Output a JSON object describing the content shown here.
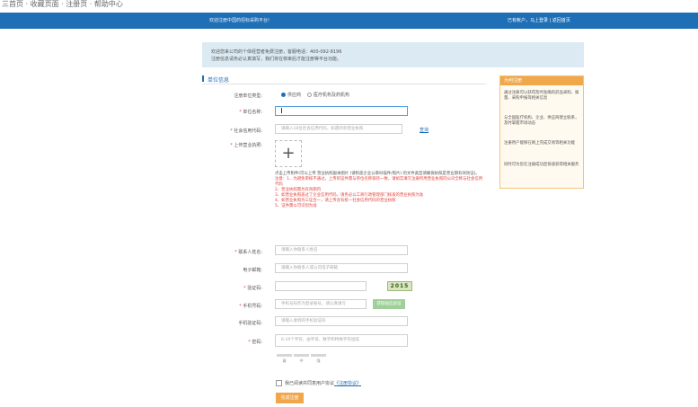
{
  "top_strip": "三首页 · 收藏页面 · 注册页 · 帮助中心",
  "header": {
    "welcome": "欢迎注册中国药招标采购平台!",
    "links": "已有帐户，马上登录 | 返回首页"
  },
  "notice": {
    "line1": "欢迎您来公司的个体经营者免费注册，客服电话：400-092-8196",
    "line2": "注册信息请务必认真填写，我们将在核审后才能注册等平台功能。"
  },
  "section_title": "单位信息",
  "form": {
    "type_label": "注册单位类型:",
    "type_options": [
      "供应商",
      "医疗机构及药机构"
    ],
    "name_label": "单位名称:",
    "credit_label": "社会信用代码:",
    "credit_placeholder": "请输入18位社会信用代码，如遇到有营业执照",
    "credit_link": "查询",
    "license_label": "上传营业执照:",
    "upload_plus": "+",
    "tips": [
      {
        "text": "点击上传附件(可以上传 营业执照副本图片 (请附盖企业公章扫描件/照片) 的文件类型请确保执照是营业期有效效证)。",
        "color": "dark"
      },
      {
        "text": "注意：1、为避免审核不通过，上传的证件需与单位名称保持一致，请如实填写注册所用营业执照的公司全称与社会信用代码",
        "color": "red"
      },
      {
        "text": "2、营业执照需为有效期内",
        "color": "red"
      },
      {
        "text": "3、如营业执照盖过了企业信用代码，请务必以工商行政管理部门核发的营业执照为准",
        "color": "red"
      },
      {
        "text": "4、如营业执照为三证合一，请上传含有统一社会信用代码的营业执照",
        "color": "red"
      },
      {
        "text": "5、证件需以可识别为准",
        "color": "red"
      }
    ],
    "contact_label": "联系人姓名:",
    "contact_placeholder": "请输入你联系人姓名",
    "email_label": "电子邮箱:",
    "email_placeholder": "请输入你联系人或公司电子邮箱",
    "captcha_label": "验证码:",
    "captcha_text": "2015",
    "phone_label": "手机号码:",
    "phone_placeholder": "手机号码作为登录账号，请认真填写",
    "sms_button": "获取短信验证",
    "sms_label": "手机验证码:",
    "sms_placeholder": "请输入收到的手机验证码",
    "password_label": "密码:",
    "password_placeholder": "6-16个字符，由字母、数字和特殊字符组成",
    "strength_labels": [
      "弱",
      "中",
      "强"
    ],
    "agree_text": "我已阅读并同意用户协议",
    "agree_link": "《注册协议》",
    "submit": "完成注册"
  },
  "sidebar": {
    "title": "为何注册",
    "items": [
      "通过注册可以获得及时准确的药品采购、报量、采购申报等相关信息",
      "与全国医疗机构、企业、供应商建立联系，及时掌握市场动态",
      "注册用户能够在网上完成交易等相关功能",
      "同时可为您在注册成功后快速获得相关服务"
    ]
  }
}
